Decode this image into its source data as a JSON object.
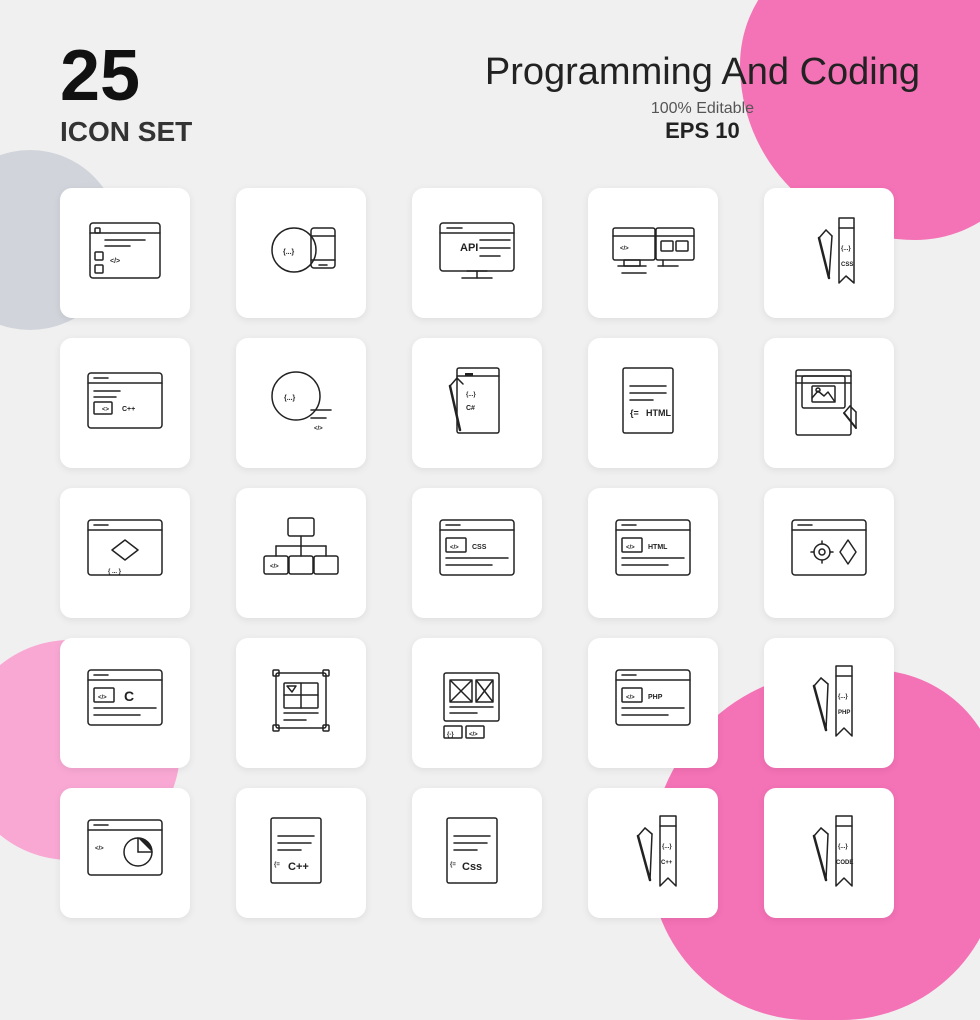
{
  "header": {
    "number": "25",
    "icon_set_label": "ICON SET",
    "title": "Programming And Coding",
    "editable": "100% Editable",
    "eps": "EPS 10"
  },
  "icons": [
    {
      "id": 1,
      "type": "browser-code",
      "label": "browser with code tags"
    },
    {
      "id": 2,
      "type": "circle-dots-mobile",
      "label": "circle dots with mobile"
    },
    {
      "id": 3,
      "type": "api-monitor",
      "label": "API monitor"
    },
    {
      "id": 4,
      "type": "dual-monitor-code",
      "label": "dual monitor code"
    },
    {
      "id": 5,
      "type": "pencil-css",
      "label": "pencil CSS bookmark"
    },
    {
      "id": 6,
      "type": "browser-cpp",
      "label": "browser C++"
    },
    {
      "id": 7,
      "type": "circle-dots-code",
      "label": "circle curly brackets code"
    },
    {
      "id": 8,
      "type": "pencil-csharp",
      "label": "pencil C# book"
    },
    {
      "id": 9,
      "type": "html-file",
      "label": "HTML file"
    },
    {
      "id": 10,
      "type": "book-image",
      "label": "book with image icon"
    },
    {
      "id": 11,
      "type": "browser-diamond",
      "label": "browser diamond"
    },
    {
      "id": 12,
      "type": "flowchart",
      "label": "flowchart diagram"
    },
    {
      "id": 13,
      "type": "browser-css",
      "label": "browser CSS"
    },
    {
      "id": 14,
      "type": "browser-html",
      "label": "browser HTML"
    },
    {
      "id": 15,
      "type": "browser-gear-diamond",
      "label": "browser gear diamond"
    },
    {
      "id": 16,
      "type": "browser-c",
      "label": "browser C language"
    },
    {
      "id": 17,
      "type": "design-tool",
      "label": "design tool frame"
    },
    {
      "id": 18,
      "type": "wireframe",
      "label": "wireframe layout"
    },
    {
      "id": 19,
      "type": "browser-php",
      "label": "browser PHP"
    },
    {
      "id": 20,
      "type": "pencil-php",
      "label": "pencil PHP bookmark"
    },
    {
      "id": 21,
      "type": "browser-chart",
      "label": "browser with chart"
    },
    {
      "id": 22,
      "type": "file-cpp",
      "label": "file C++"
    },
    {
      "id": 23,
      "type": "file-css",
      "label": "file CSS"
    },
    {
      "id": 24,
      "type": "pencil-cpp",
      "label": "pencil C++ bookmark"
    },
    {
      "id": 25,
      "type": "pencil-code",
      "label": "pencil CODE bookmark"
    }
  ]
}
